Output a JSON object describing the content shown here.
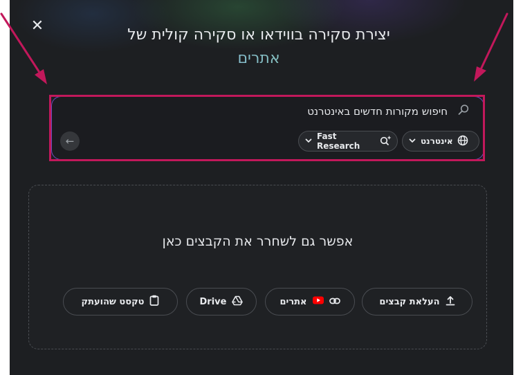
{
  "dialog": {
    "close_symbol": "✕",
    "title_line1": "יצירת סקירה בווידאו או סקירה קולית של",
    "title_line2": "אתרים"
  },
  "search": {
    "placeholder": "חיפוש מקורות חדשים באינטרנט",
    "web_chip_label": "אינטרנט",
    "research_chip_label": "Fast Research",
    "back_symbol": "←"
  },
  "dropzone": {
    "text": "אפשר גם לשחרר את הקבצים כאן",
    "buttons": {
      "upload": "העלאת קבצים",
      "websites": "אתרים",
      "drive": "Drive",
      "paste": "טקסט שהועתק"
    }
  },
  "colors": {
    "annotation": "#c2185b",
    "accent_blue": "#8ab4f8",
    "accent_green": "#81c995",
    "youtube_red": "#ff0000"
  },
  "icons": [
    "close-icon",
    "search-icon",
    "globe-icon",
    "chevron-down-icon",
    "sparkle-search-icon",
    "arrow-back-icon",
    "upload-icon",
    "link-icon",
    "youtube-icon",
    "drive-icon",
    "clipboard-icon"
  ]
}
